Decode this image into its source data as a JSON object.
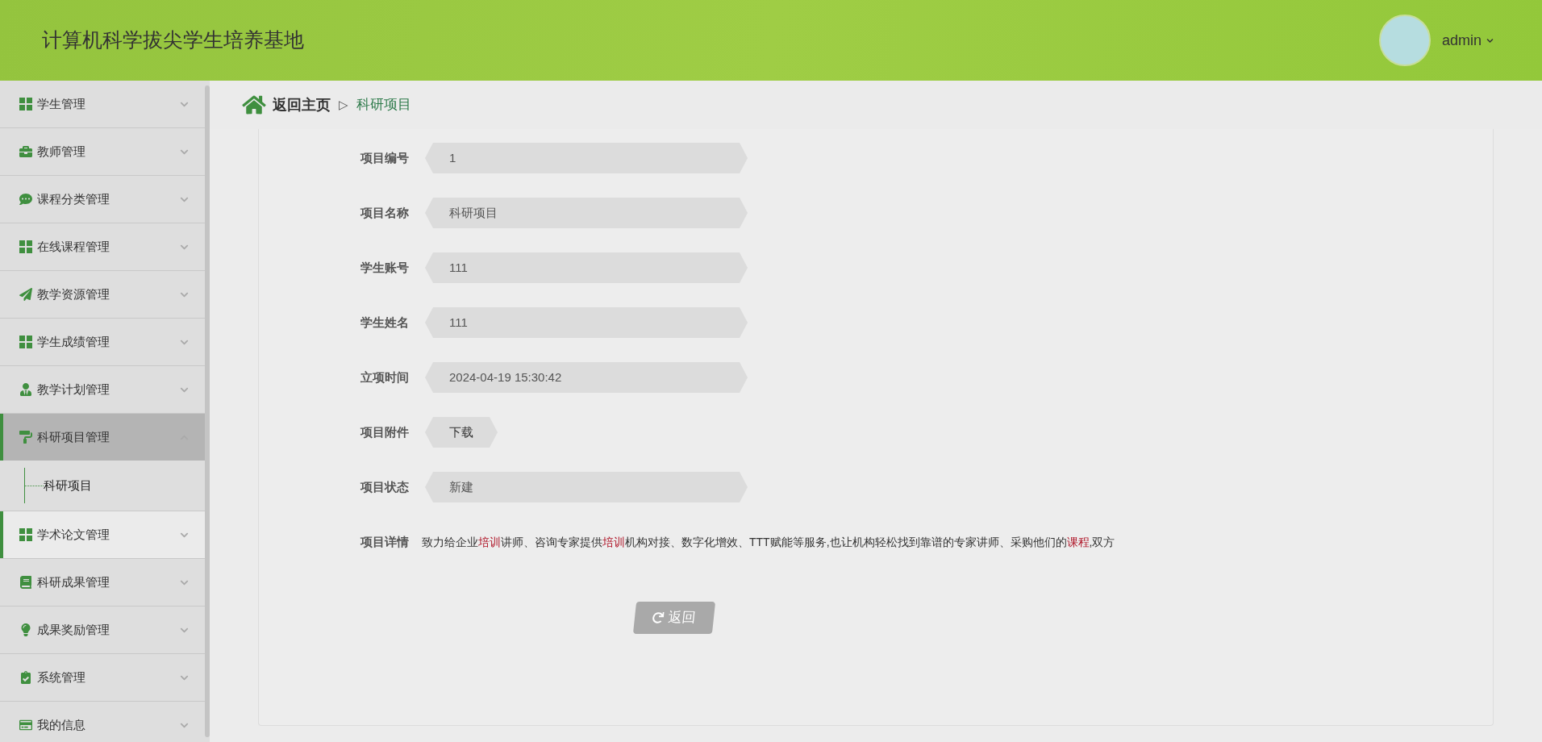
{
  "header": {
    "title": "计算机科学拔尖学生培养基地",
    "user": "admin"
  },
  "sidebar": {
    "items": [
      {
        "label": "学生管理",
        "expanded": false,
        "highlighted": false
      },
      {
        "label": "教师管理",
        "expanded": false,
        "highlighted": false
      },
      {
        "label": "课程分类管理",
        "expanded": false,
        "highlighted": false
      },
      {
        "label": "在线课程管理",
        "expanded": false,
        "highlighted": false
      },
      {
        "label": "教学资源管理",
        "expanded": false,
        "highlighted": false
      },
      {
        "label": "学生成绩管理",
        "expanded": false,
        "highlighted": false
      },
      {
        "label": "教学计划管理",
        "expanded": false,
        "highlighted": false
      },
      {
        "label": "科研项目管理",
        "expanded": true,
        "highlighted": false,
        "children": [
          {
            "label": "科研项目"
          }
        ]
      },
      {
        "label": "学术论文管理",
        "expanded": false,
        "highlighted": true
      },
      {
        "label": "科研成果管理",
        "expanded": false,
        "highlighted": false
      },
      {
        "label": "成果奖励管理",
        "expanded": false,
        "highlighted": false
      },
      {
        "label": "系统管理",
        "expanded": false,
        "highlighted": false
      },
      {
        "label": "我的信息",
        "expanded": false,
        "highlighted": false
      }
    ]
  },
  "breadcrumb": {
    "home": "返回主页",
    "separator": "▷",
    "current": "科研项目"
  },
  "form": {
    "fields": [
      {
        "kind": "field",
        "label": "项目编号",
        "value": "1"
      },
      {
        "kind": "field",
        "label": "项目名称",
        "value": "科研项目"
      },
      {
        "kind": "field",
        "label": "学生账号",
        "value": "111"
      },
      {
        "kind": "field",
        "label": "学生姓名",
        "value": "111"
      },
      {
        "kind": "field",
        "label": "立项时间",
        "value": "2024-04-19 15:30:42"
      },
      {
        "kind": "download",
        "label": "项目附件",
        "value": "下载"
      },
      {
        "kind": "field",
        "label": "项目状态",
        "value": "新建"
      }
    ],
    "detail": {
      "label": "项目详情",
      "segments": [
        {
          "text": "致力给企业",
          "highlight": false
        },
        {
          "text": "培训",
          "highlight": true
        },
        {
          "text": "讲师、咨询专家提供",
          "highlight": false
        },
        {
          "text": "培训",
          "highlight": true
        },
        {
          "text": "机构对接、数字化增效、TTT赋能等服务,也让机构轻松找到靠谱的专家讲师、采购他们的",
          "highlight": false
        },
        {
          "text": "课程",
          "highlight": true
        },
        {
          "text": ",双方",
          "highlight": false
        }
      ]
    },
    "back_button": "返回"
  }
}
